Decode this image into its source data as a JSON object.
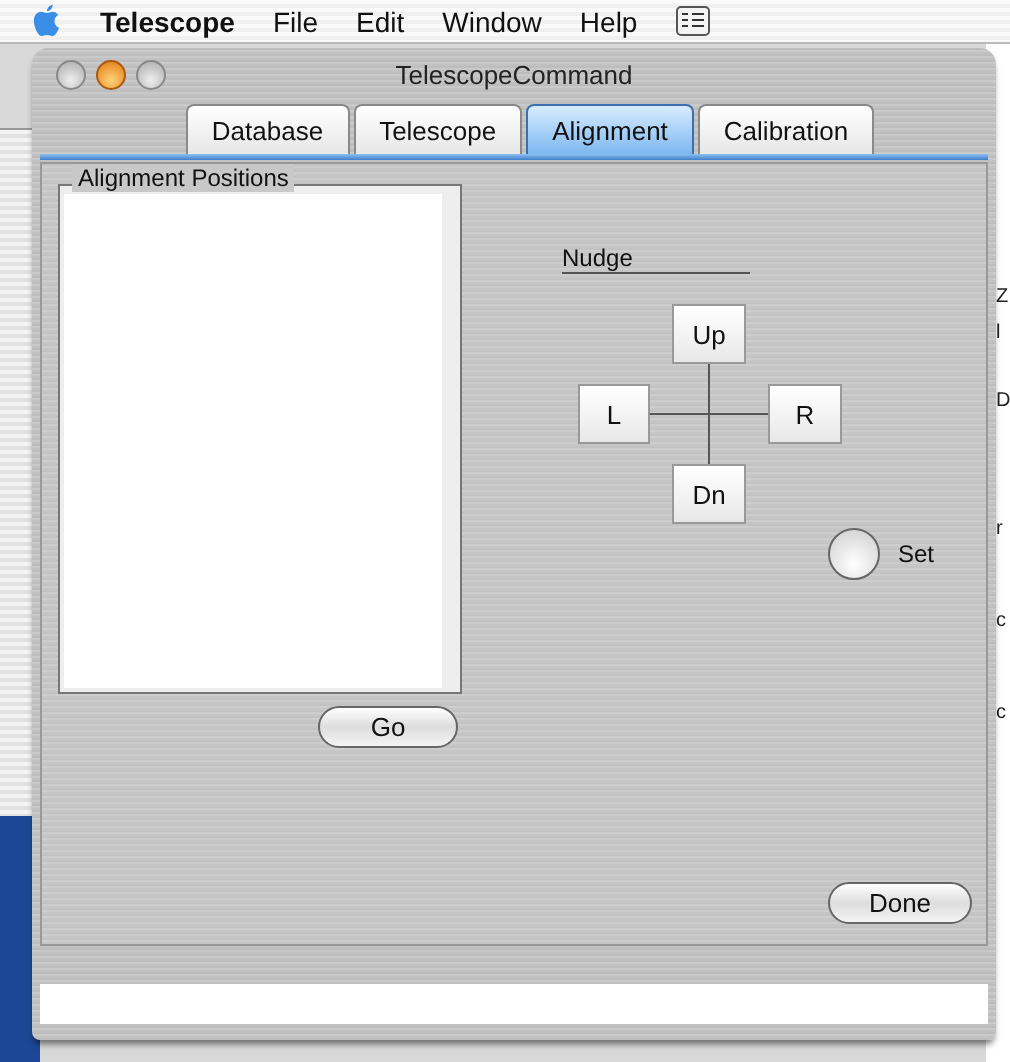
{
  "menu_bar": {
    "app": "Telescope",
    "items": [
      "File",
      "Edit",
      "Window",
      "Help"
    ]
  },
  "background_window": {
    "blocks": [
      [
        "Z",
        "l"
      ],
      [
        "D"
      ],
      [
        "r"
      ],
      [
        "c"
      ],
      [
        "c"
      ]
    ]
  },
  "window": {
    "title": "TelescopeCommand"
  },
  "tabs": [
    {
      "label": "Database",
      "selected": false
    },
    {
      "label": "Telescope",
      "selected": false
    },
    {
      "label": "Alignment",
      "selected": true
    },
    {
      "label": "Calibration",
      "selected": false
    }
  ],
  "alignment_positions": {
    "title": "Alignment Positions",
    "go_button": "Go"
  },
  "nudge": {
    "title": "Nudge",
    "up": "Up",
    "left": "L",
    "right": "R",
    "down": "Dn"
  },
  "set_radio": {
    "label": "Set",
    "selected": false
  },
  "done_button": "Done"
}
